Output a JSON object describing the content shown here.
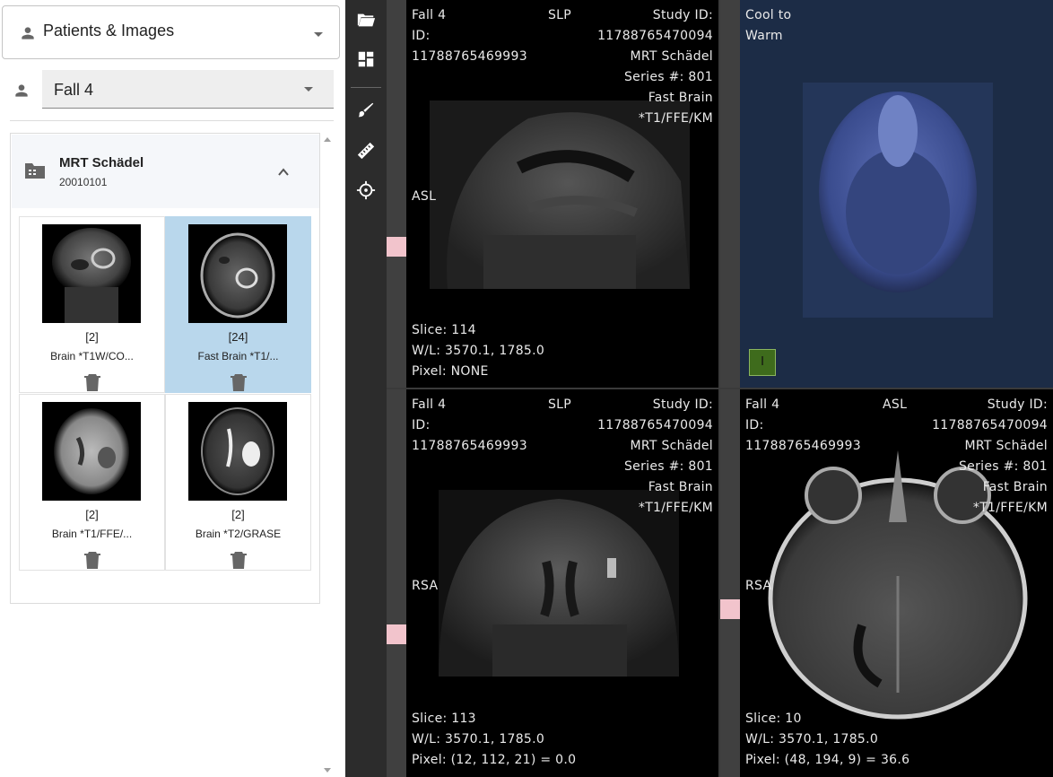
{
  "sidebar": {
    "header_select": {
      "label": "Patients & Images"
    },
    "patient_select": {
      "value": "Fall 4"
    },
    "study": {
      "title": "MRT Schädel",
      "date": "20010101",
      "series": [
        {
          "count": "[2]",
          "name": "Brain *T1W/CO...",
          "selected": false
        },
        {
          "count": "[24]",
          "name": "Fast Brain *T1/...",
          "selected": true
        },
        {
          "count": "[2]",
          "name": "Brain *T1/FFE/...",
          "selected": false
        },
        {
          "count": "[2]",
          "name": "Brain *T2/GRASE",
          "selected": false
        }
      ]
    }
  },
  "toolbar": {
    "icons": [
      "folder-open-icon",
      "layout-icon",
      "brush-icon",
      "ruler-icon",
      "crosshair-icon"
    ]
  },
  "viewports": {
    "top_left": {
      "patient": "Fall 4",
      "orientation_code": "SLP",
      "id_label": "ID:",
      "patient_id": "11788765469993",
      "study_id_label": "Study ID:",
      "study_id": "11788765470094",
      "study_desc": "MRT Schädel",
      "series_num": "Series #: 801",
      "series_desc_1": "Fast Brain",
      "series_desc_2": "*T1/FFE/KM",
      "left_marker": "ASL",
      "slice": "Slice: 114",
      "wl": "W/L: 3570.1, 1785.0",
      "pixel": "Pixel: NONE"
    },
    "top_right": {
      "colormap_1": "Cool to",
      "colormap_2": "Warm",
      "button_label": "I"
    },
    "bottom_left": {
      "patient": "Fall 4",
      "orientation_code": "SLP",
      "id_label": "ID:",
      "patient_id": "11788765469993",
      "study_id_label": "Study ID:",
      "study_id": "11788765470094",
      "study_desc": "MRT Schädel",
      "series_num": "Series #: 801",
      "series_desc_1": "Fast Brain",
      "series_desc_2": "*T1/FFE/KM",
      "left_marker": "RSA",
      "slice": "Slice: 113",
      "wl": "W/L: 3570.1, 1785.0",
      "pixel": "Pixel: (12, 112, 21) = 0.0"
    },
    "bottom_right": {
      "patient": "Fall 4",
      "orientation_code": "ASL",
      "id_label": "ID:",
      "patient_id": "11788765469993",
      "study_id_label": "Study ID:",
      "study_id": "11788765470094",
      "study_desc": "MRT Schädel",
      "series_num": "Series #: 801",
      "series_desc_1": "Fast Brain",
      "series_desc_2": "*T1/FFE/KM",
      "left_marker": "RSA",
      "slice": "Slice: 10",
      "wl": "W/L: 3570.1, 1785.0",
      "pixel": "Pixel: (48, 194, 9) = 36.6"
    }
  },
  "colors": {
    "selected_tile": "#b9d7ec",
    "toolbar_bg": "#2c2c2c",
    "volume_bg": "#1c2c46",
    "slice_marker": "#f2c4cc"
  }
}
